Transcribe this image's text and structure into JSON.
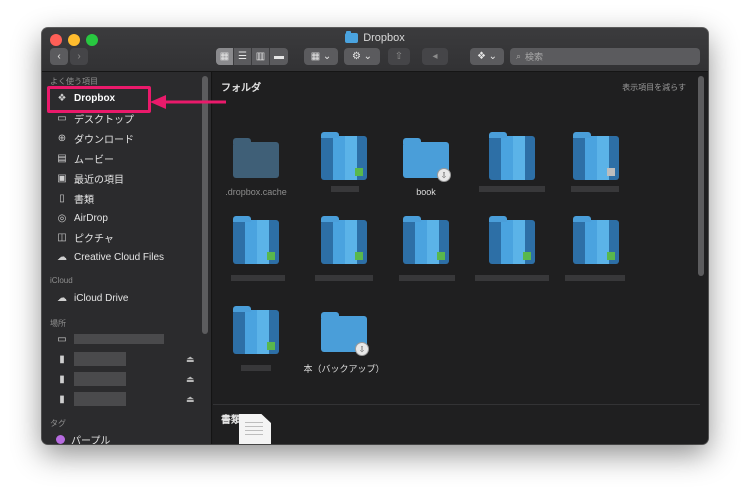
{
  "window": {
    "title": "Dropbox"
  },
  "toolbar": {
    "back": "‹",
    "forward": "›",
    "view_icons": [
      "icon-view-icon",
      "list-view-icon",
      "column-view-icon",
      "gallery-view-icon"
    ],
    "search_placeholder": "検索"
  },
  "sidebar": {
    "favorites_header": "よく使う項目",
    "items": [
      {
        "label": "Dropbox",
        "icon": "dropbox-icon"
      },
      {
        "label": "デスクトップ",
        "icon": "desktop-icon"
      },
      {
        "label": "ダウンロード",
        "icon": "download-icon"
      },
      {
        "label": "ムービー",
        "icon": "movie-icon"
      },
      {
        "label": "最近の項目",
        "icon": "clock-icon"
      },
      {
        "label": "書類",
        "icon": "document-icon"
      },
      {
        "label": "AirDrop",
        "icon": "airdrop-icon"
      },
      {
        "label": "ピクチャ",
        "icon": "camera-icon"
      },
      {
        "label": "Creative Cloud Files",
        "icon": "creative-cloud-icon"
      }
    ],
    "icloud_header": "iCloud",
    "icloud_drive": "iCloud Drive",
    "locations_header": "場所",
    "eject": "⏏",
    "tags_header": "タグ",
    "tag_purple": "パープル"
  },
  "main": {
    "folders_header": "フォルダ",
    "show_less": "表示項目を減らす",
    "documents_header": "書類",
    "folders": [
      {
        "name": ".dropbox.cache"
      },
      {
        "name": "book"
      },
      {
        "name": "本（バックアップ）"
      }
    ]
  },
  "colors": {
    "highlight": "#ea1a6b",
    "folder": "#4a9ed9",
    "background": "#1f1f20"
  }
}
